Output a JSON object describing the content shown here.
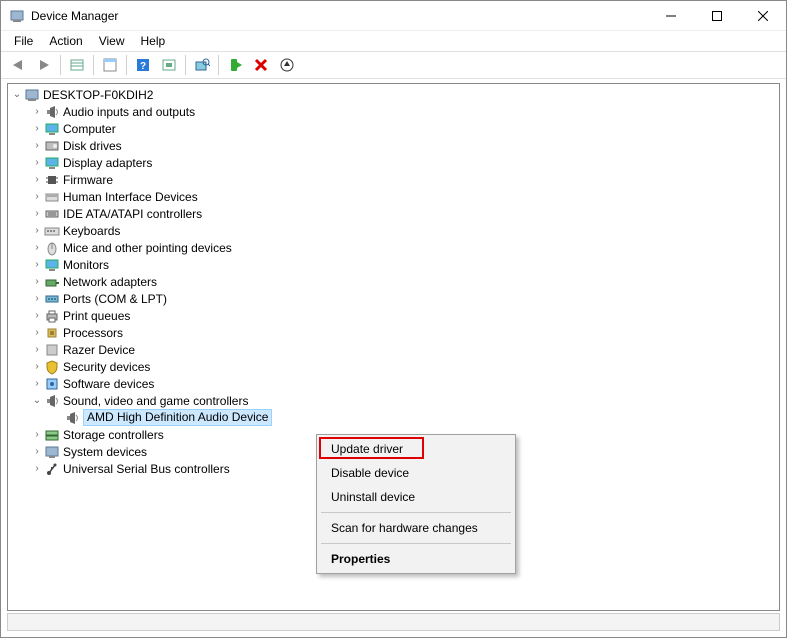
{
  "window": {
    "title": "Device Manager"
  },
  "menu": {
    "items": [
      "File",
      "Action",
      "View",
      "Help"
    ]
  },
  "tree": {
    "root": "DESKTOP-F0KDIH2",
    "categories": [
      {
        "label": "Audio inputs and outputs",
        "icon": "speaker"
      },
      {
        "label": "Computer",
        "icon": "monitor"
      },
      {
        "label": "Disk drives",
        "icon": "disk"
      },
      {
        "label": "Display adapters",
        "icon": "monitor"
      },
      {
        "label": "Firmware",
        "icon": "chip"
      },
      {
        "label": "Human Interface Devices",
        "icon": "hid"
      },
      {
        "label": "IDE ATA/ATAPI controllers",
        "icon": "ide"
      },
      {
        "label": "Keyboards",
        "icon": "keyboard"
      },
      {
        "label": "Mice and other pointing devices",
        "icon": "mouse"
      },
      {
        "label": "Monitors",
        "icon": "monitor"
      },
      {
        "label": "Network adapters",
        "icon": "net"
      },
      {
        "label": "Ports (COM & LPT)",
        "icon": "port"
      },
      {
        "label": "Print queues",
        "icon": "printer"
      },
      {
        "label": "Processors",
        "icon": "cpu"
      },
      {
        "label": "Razer Device",
        "icon": "generic"
      },
      {
        "label": "Security devices",
        "icon": "shield"
      },
      {
        "label": "Software devices",
        "icon": "soft"
      },
      {
        "label": "Sound, video and game controllers",
        "icon": "speaker",
        "expanded": true,
        "children": [
          {
            "label": "AMD High Definition Audio Device",
            "icon": "speaker",
            "selected": true
          }
        ]
      },
      {
        "label": "Storage controllers",
        "icon": "storage"
      },
      {
        "label": "System devices",
        "icon": "system"
      },
      {
        "label": "Universal Serial Bus controllers",
        "icon": "usb"
      }
    ]
  },
  "context_menu": {
    "items": [
      {
        "label": "Update driver",
        "highlighted": true
      },
      {
        "label": "Disable device"
      },
      {
        "label": "Uninstall device"
      },
      {
        "sep": true
      },
      {
        "label": "Scan for hardware changes"
      },
      {
        "sep": true
      },
      {
        "label": "Properties",
        "bold": true
      }
    ]
  }
}
